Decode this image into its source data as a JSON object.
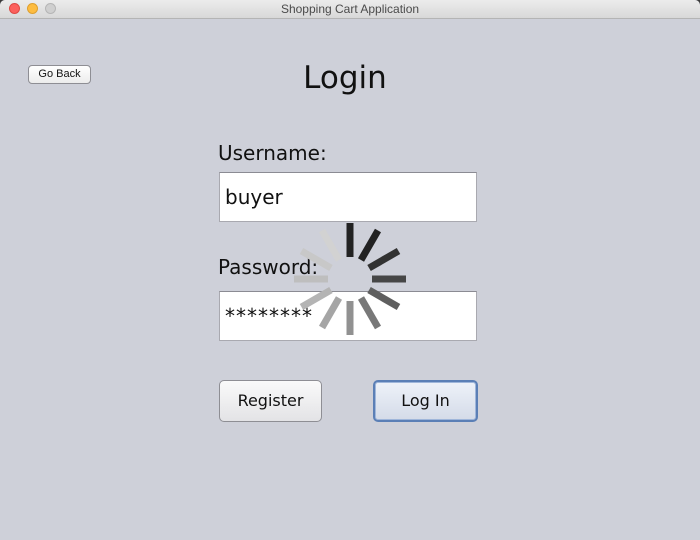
{
  "window": {
    "title": "Shopping Cart Application"
  },
  "nav": {
    "back_label": "Go Back"
  },
  "form": {
    "title": "Login",
    "username_label": "Username:",
    "username_value": "buyer",
    "password_label": "Password:",
    "password_value": "********"
  },
  "actions": {
    "register_label": "Register",
    "login_label": "Log In"
  },
  "spinner": {
    "icon": "loading-spinner-icon"
  },
  "colors": {
    "window_bg": "#ced0d9",
    "focus_accent": "#5b7fb6",
    "close": "#fc605c",
    "minimize": "#fdbc40",
    "zoom": "#cfcfcf"
  }
}
